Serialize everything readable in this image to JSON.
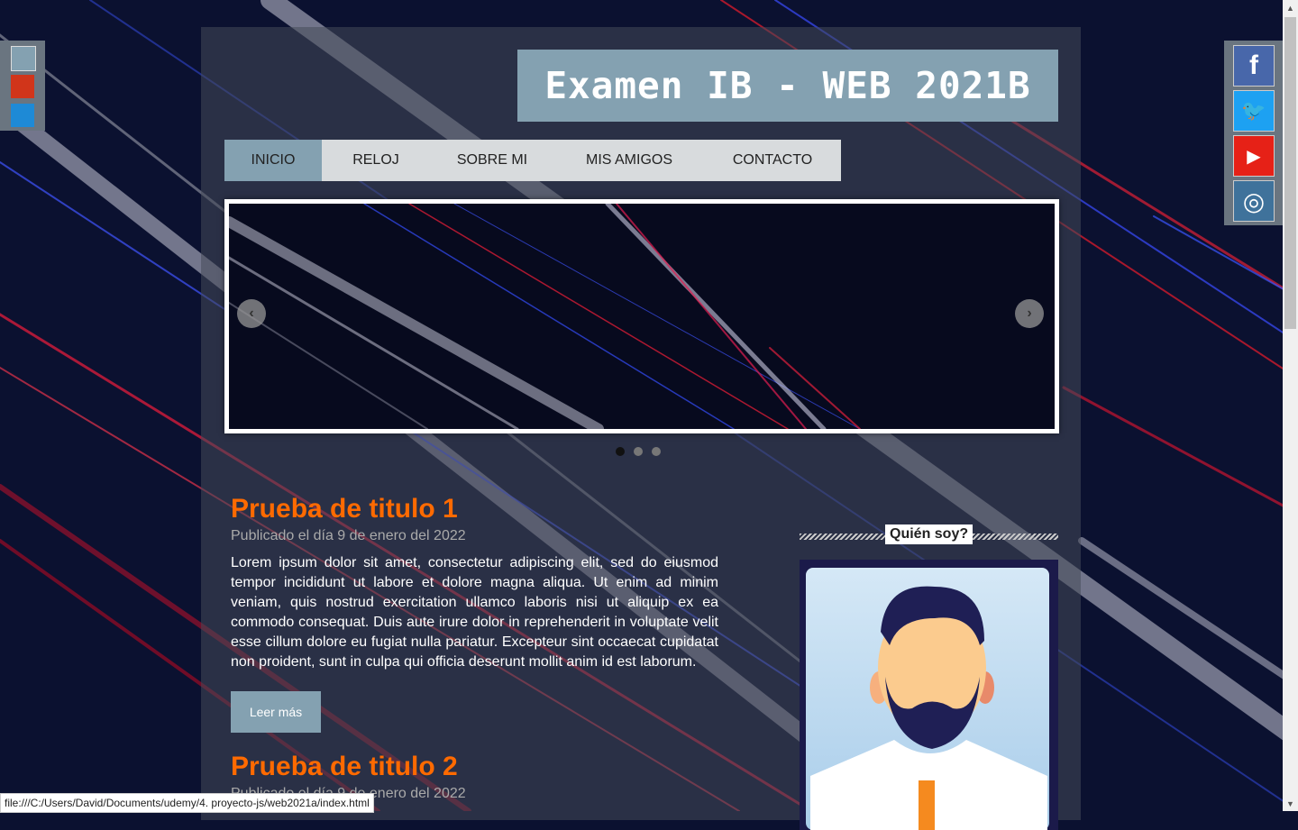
{
  "site": {
    "title": "Examen IB - WEB 2021B"
  },
  "nav": {
    "items": [
      "INICIO",
      "RELOJ",
      "SOBRE MI",
      "MIS AMIGOS",
      "CONTACTO"
    ],
    "active": "INICIO"
  },
  "slider": {
    "prev_glyph": "‹",
    "next_glyph": "›",
    "dots": 3,
    "active_dot": 1
  },
  "articles": [
    {
      "title": "Prueba de titulo 1",
      "date": "Publicado el día 9 de enero del 2022",
      "body": "Lorem ipsum dolor sit amet, consectetur adipiscing elit, sed do eiusmod tempor incididunt ut labore et dolore magna aliqua. Ut enim ad minim veniam, quis nostrud exercitation ullamco laboris nisi ut aliquip ex ea commodo consequat. Duis aute irure dolor in reprehenderit in voluptate velit esse cillum dolore eu fugiat nulla pariatur. Excepteur sint occaecat cupidatat non proident, sunt in culpa qui officia deserunt mollit anim id est laborum.",
      "button": "Leer más"
    },
    {
      "title": "Prueba de titulo 2",
      "date": "Publicado el día 9 de enero del 2022"
    }
  ],
  "sidebar": {
    "title": "Quién soy?"
  },
  "color_switcher": {
    "colors": [
      "#84a1b1",
      "#d1351a",
      "#1e8ad6"
    ]
  },
  "social": {
    "items": [
      {
        "name": "facebook",
        "glyph": "f",
        "color": "#4867aa"
      },
      {
        "name": "twitter",
        "glyph": "🐦",
        "color": "#1da1f2"
      },
      {
        "name": "youtube",
        "glyph": "▶",
        "color": "#e62117"
      },
      {
        "name": "instagram",
        "glyph": "◎",
        "color": "#3f729b"
      }
    ]
  },
  "statusbar": {
    "url": "file:///C:/Users/David/Documents/udemy/4. proyecto-js/web2021a/index.html"
  }
}
